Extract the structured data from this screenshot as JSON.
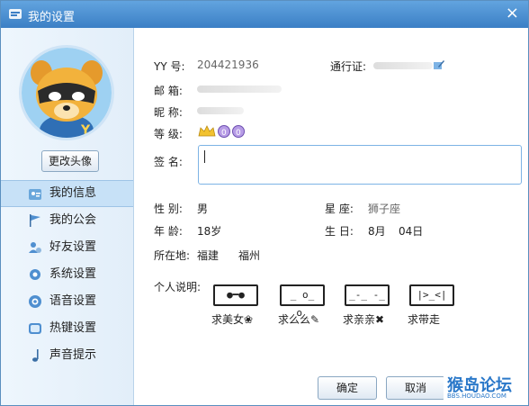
{
  "window": {
    "title": "我的设置"
  },
  "avatar": {
    "change_label": "更改头像"
  },
  "nav": [
    {
      "label": "我的信息",
      "icon": "profile-card-icon",
      "active": true
    },
    {
      "label": "我的公会",
      "icon": "flag-icon"
    },
    {
      "label": "好友设置",
      "icon": "friends-gear-icon"
    },
    {
      "label": "系统设置",
      "icon": "gear-icon"
    },
    {
      "label": "语音设置",
      "icon": "speaker-icon"
    },
    {
      "label": "热键设置",
      "icon": "keyboard-icon"
    },
    {
      "label": "声音提示",
      "icon": "music-note-icon"
    }
  ],
  "profile": {
    "yy_label": "YY  号:",
    "yy_value": "204421936",
    "passport_label": "通行证:",
    "email_label": "邮    箱:",
    "nick_label": "昵    称:",
    "level_label": "等    级:",
    "sig_label": "签    名:",
    "gender_label": "性    别:",
    "gender_value": "男",
    "zodiac_label": "星    座:",
    "zodiac_value": "狮子座",
    "age_label": "年    龄:",
    "age_value": "18岁",
    "birthday_label": "生    日:",
    "birth_month": "8月",
    "birth_day": "04日",
    "location_label": "所在地:",
    "province": "福建",
    "city": "福州",
    "about_label": "个人说明:"
  },
  "emoticons": [
    {
      "face": "●━●",
      "caption": "求美女❀"
    },
    {
      "face": "_ o_ o_",
      "caption": "求么么✎"
    },
    {
      "face": "_‐_ ‐_",
      "caption": "求亲亲✖"
    },
    {
      "face": "|>_<|",
      "caption": "求带走"
    }
  ],
  "buttons": {
    "ok": "确定",
    "cancel": "取消"
  },
  "watermark": {
    "top": "猴岛论坛",
    "bottom": "BBS.HOUDAO.COM"
  },
  "colors": {
    "titlebar": "#4a90d3",
    "accent": "#7db3e5",
    "sidebar": "#e8f2fb"
  }
}
